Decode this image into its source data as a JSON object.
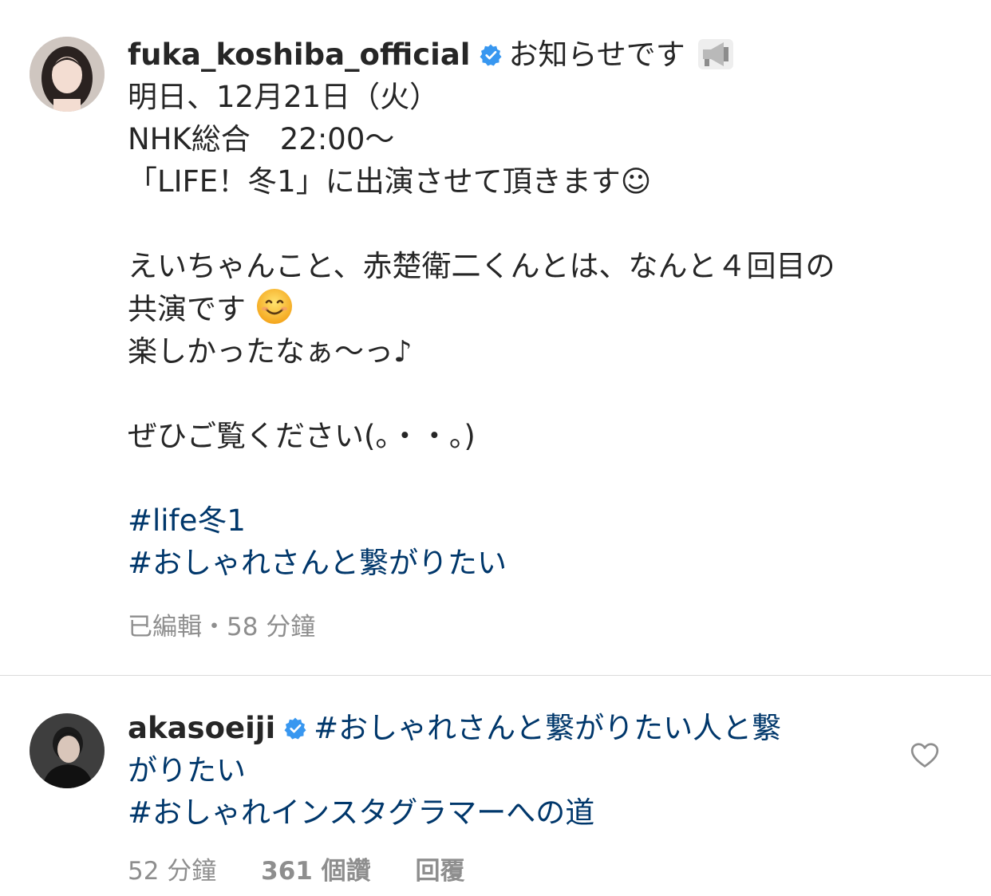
{
  "post": {
    "username": "fuka_koshiba_official",
    "verified": true,
    "caption_lines": [
      "お知らせです",
      "明日、12月21日（火）",
      "NHK総合　22:00～",
      "「LIFE！冬1」に出演させて頂きます☺",
      "",
      "えいちゃんこと、赤楚衛二くんとは、なんと４回目の",
      "共演です",
      "楽しかったなぁ〜っ♪",
      "",
      "ぜひご覧ください(。・・。)",
      ""
    ],
    "hashtags": [
      "#life冬1",
      "#おしゃれさんと繋がりたい"
    ],
    "meta": "已編輯・58 分鐘"
  },
  "comment": {
    "username": "akasoeiji",
    "verified": true,
    "text_line1": "#おしゃれさんと繋がりたい人と繋",
    "text_line2": "がりたい",
    "text_line3": "#おしゃれインスタグラマーへの道",
    "time": "52 分鐘",
    "likes": "361 個讚",
    "reply": "回覆"
  },
  "icons": {
    "verified": "verified-badge-icon",
    "megaphone": "megaphone-icon",
    "smile": "smiling-face-emoji",
    "heart": "heart-outline-icon"
  },
  "colors": {
    "text": "#262626",
    "hashtag": "#00376b",
    "meta": "#8e8e8e",
    "verified": "#3897f0",
    "divider": "#dbdbdb"
  }
}
